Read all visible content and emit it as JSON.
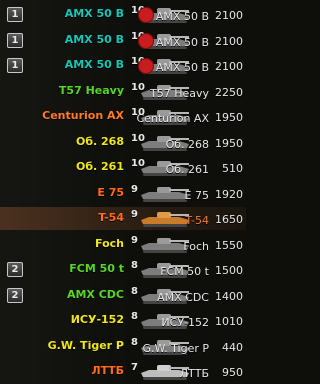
{
  "colors": {
    "teal": "#17c6b7",
    "green": "#57d629",
    "orange": "#ff7b21",
    "yellow": "#f0e61b",
    "orangeRed": "#ff6a1a",
    "white": "#e7e7e7"
  },
  "rows": [
    {
      "platoon": "1",
      "player": "AMX 50 B",
      "color": "teal",
      "tier": "10",
      "icon": "french-heavy-tank-icon",
      "emblem": true,
      "vehicle": "AMX 50 B",
      "rating": "2100"
    },
    {
      "platoon": "1",
      "player": "AMX 50 B",
      "color": "teal",
      "tier": "10",
      "icon": "french-heavy-tank-icon",
      "emblem": true,
      "vehicle": "AMX 50 B",
      "rating": "2100"
    },
    {
      "platoon": "1",
      "player": "AMX 50 B",
      "color": "teal",
      "tier": "10",
      "icon": "french-heavy-tank-icon",
      "emblem": true,
      "vehicle": "AMX 50 B",
      "rating": "2100"
    },
    {
      "platoon": "",
      "player": "T57 Heavy",
      "color": "green",
      "tier": "10",
      "icon": "heavy-tank-icon",
      "emblem": false,
      "vehicle": "T57 Heavy",
      "rating": "2250"
    },
    {
      "platoon": "",
      "player": "Centurion AX",
      "color": "orange",
      "tier": "10",
      "icon": "medium-tank-icon",
      "emblem": false,
      "vehicle": "Centurion AX",
      "rating": "1950"
    },
    {
      "platoon": "",
      "player": "Об. 268",
      "color": "yellow",
      "tier": "10",
      "icon": "td-icon",
      "emblem": false,
      "vehicle": "Об. 268",
      "rating": "1950"
    },
    {
      "platoon": "",
      "player": "Об. 261",
      "color": "yellow",
      "tier": "10",
      "icon": "spg-icon",
      "emblem": false,
      "vehicle": "Об. 261",
      "rating": "510"
    },
    {
      "platoon": "",
      "player": "E 75",
      "color": "orangeRed",
      "tier": "9",
      "icon": "heavy-tank-icon",
      "emblem": false,
      "vehicle": "E 75",
      "rating": "1920"
    },
    {
      "platoon": "",
      "player": "T-54",
      "color": "orangeRed",
      "tier": "9",
      "icon": "medium-tank-icon",
      "emblem": false,
      "vehicle": "T-54",
      "rating": "1650",
      "highlight": true
    },
    {
      "platoon": "",
      "player": "Foch",
      "color": "yellow",
      "tier": "9",
      "icon": "td-icon",
      "emblem": false,
      "vehicle": "Foch",
      "rating": "1550"
    },
    {
      "platoon": "2",
      "player": "FCM 50 t",
      "color": "green",
      "tier": "8",
      "icon": "medium-tank-icon",
      "emblem": false,
      "vehicle": "FCM 50 t",
      "rating": "1500"
    },
    {
      "platoon": "2",
      "player": "AMX CDC",
      "color": "green",
      "tier": "8",
      "icon": "medium-tank-icon",
      "emblem": false,
      "vehicle": "AMX CDC",
      "rating": "1400"
    },
    {
      "platoon": "",
      "player": "ИСУ-152",
      "color": "yellow",
      "tier": "8",
      "icon": "td-icon",
      "emblem": false,
      "vehicle": "ИСУ-152",
      "rating": "1010"
    },
    {
      "platoon": "",
      "player": "G.W. Tiger P",
      "color": "yellow",
      "tier": "8",
      "icon": "spg-icon",
      "emblem": false,
      "vehicle": "G.W. Tiger P",
      "rating": "440"
    },
    {
      "platoon": "",
      "player": "ЛТТБ",
      "color": "orangeRed",
      "tier": "7",
      "icon": "light-tank-icon",
      "emblem": false,
      "vehicle": "ЛТТБ",
      "rating": "950"
    }
  ]
}
